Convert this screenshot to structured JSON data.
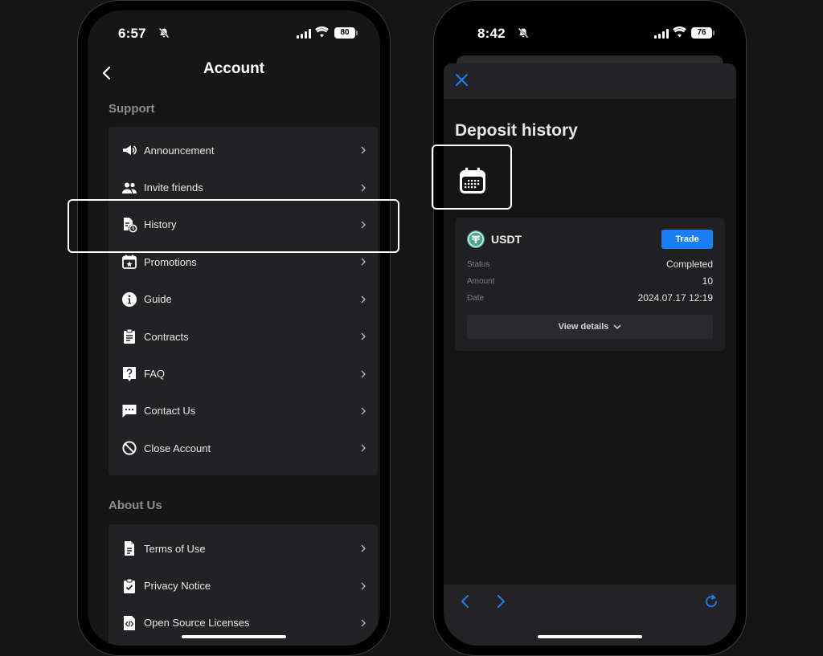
{
  "left_phone": {
    "status": {
      "time": "6:57",
      "battery": "80"
    },
    "nav": {
      "title": "Account"
    },
    "support": {
      "title": "Support",
      "items": [
        {
          "label": "Announcement",
          "icon": "megaphone-icon"
        },
        {
          "label": "Invite friends",
          "icon": "people-icon"
        },
        {
          "label": "History",
          "icon": "history-icon"
        },
        {
          "label": "Promotions",
          "icon": "calendar-star-icon"
        },
        {
          "label": "Guide",
          "icon": "info-icon"
        },
        {
          "label": "Contracts",
          "icon": "clipboard-icon"
        },
        {
          "label": "FAQ",
          "icon": "question-icon"
        },
        {
          "label": "Contact Us",
          "icon": "chat-icon"
        },
        {
          "label": "Close Account",
          "icon": "block-icon"
        }
      ]
    },
    "about": {
      "title": "About Us",
      "items": [
        {
          "label": "Terms of Use",
          "icon": "document-icon"
        },
        {
          "label": "Privacy Notice",
          "icon": "clipboard-check-icon"
        },
        {
          "label": "Open Source Licenses",
          "icon": "code-file-icon"
        }
      ]
    }
  },
  "right_phone": {
    "status": {
      "time": "8:42",
      "battery": "76"
    },
    "title": "Deposit history",
    "deposit": {
      "coin": "USDT",
      "trade_label": "Trade",
      "rows": [
        {
          "key": "Status",
          "value": "Completed"
        },
        {
          "key": "Amount",
          "value": "10"
        },
        {
          "key": "Date",
          "value": "2024.07.17 12:19"
        }
      ],
      "details_label": "View details"
    }
  },
  "colors": {
    "accent": "#1b7ef5",
    "card": "#222224",
    "background": "#161617",
    "usdt": "#4da28a"
  }
}
